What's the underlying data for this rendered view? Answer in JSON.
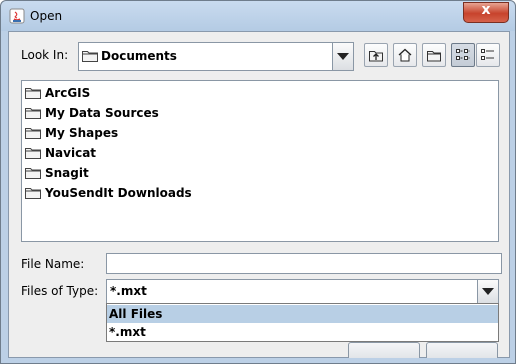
{
  "window": {
    "title": "Open",
    "close_glyph": "x"
  },
  "toolbar": {
    "look_in_label": "Look In:",
    "look_in_value": "Documents",
    "buttons": [
      {
        "name": "up-one-level-icon"
      },
      {
        "name": "home-icon"
      },
      {
        "name": "new-folder-icon"
      },
      {
        "name": "list-view-icon",
        "pressed": true
      },
      {
        "name": "details-view-icon",
        "pressed": false
      }
    ]
  },
  "files": [
    {
      "name": "ArcGIS",
      "icon": "folder-icon"
    },
    {
      "name": "My Data Sources",
      "icon": "folder-icon"
    },
    {
      "name": "My Shapes",
      "icon": "folder-icon"
    },
    {
      "name": "Navicat",
      "icon": "folder-icon"
    },
    {
      "name": "Snagit",
      "icon": "folder-icon"
    },
    {
      "name": "YouSendIt Downloads",
      "icon": "folder-icon"
    }
  ],
  "file_name": {
    "label": "File Name:",
    "value": ""
  },
  "file_type": {
    "label": "Files of Type:",
    "value": "*.mxt",
    "options": [
      {
        "label": "All Files",
        "selected": true
      },
      {
        "label": "*.mxt",
        "selected": false
      }
    ]
  },
  "colors": {
    "selection": "#b8cfe5",
    "frame": "#bcd0e6",
    "close": "#c7432c"
  }
}
